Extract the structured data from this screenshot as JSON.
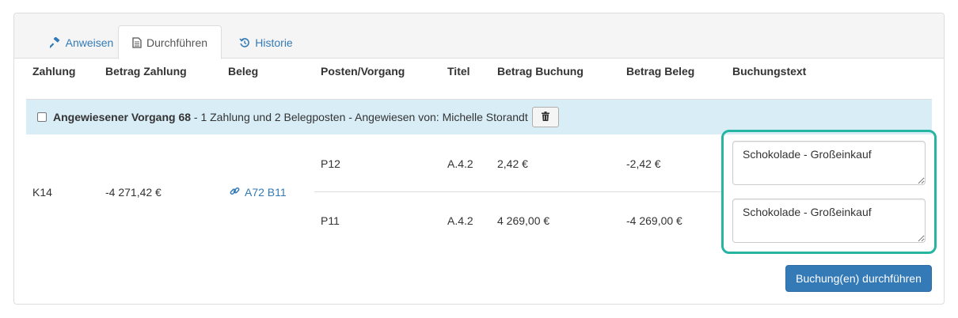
{
  "tabs": [
    {
      "label": "Anweisen",
      "icon": "gavel-icon"
    },
    {
      "label": "Durchführen",
      "icon": "document-icon"
    },
    {
      "label": "Historie",
      "icon": "history-icon"
    }
  ],
  "active_tab": "Durchführen",
  "table": {
    "headers": [
      "Zahlung",
      "Betrag Zahlung",
      "Beleg",
      "Posten/Vorgang",
      "Titel",
      "Betrag Buchung",
      "Betrag Beleg",
      "Buchungstext"
    ],
    "group": {
      "title": "Angewiesener Vorgang 68",
      "summary": " - 1 Zahlung und 2 Belegposten - Angewiesen von: Michelle Storandt",
      "checked": false
    },
    "payment": {
      "id": "K14",
      "amount": "-4 271,42 €"
    },
    "receipt": {
      "label": "A72 B11",
      "icon": "link-icon"
    },
    "rows": [
      {
        "posten": "P12",
        "titel": "A.4.2",
        "betrag_buchung": "2,42 €",
        "betrag_beleg": "-2,42 €",
        "buchungstext": "Schokolade - Großeinkauf"
      },
      {
        "posten": "P11",
        "titel": "A.4.2",
        "betrag_buchung": "4 269,00 €",
        "betrag_beleg": "-4 269,00 €",
        "buchungstext": "Schokolade - Großeinkauf"
      }
    ]
  },
  "submit_label": "Buchung(en) durchführen",
  "colors": {
    "primary": "#337ab7",
    "highlight": "#26b5a3",
    "group_bg": "#d9edf7"
  }
}
